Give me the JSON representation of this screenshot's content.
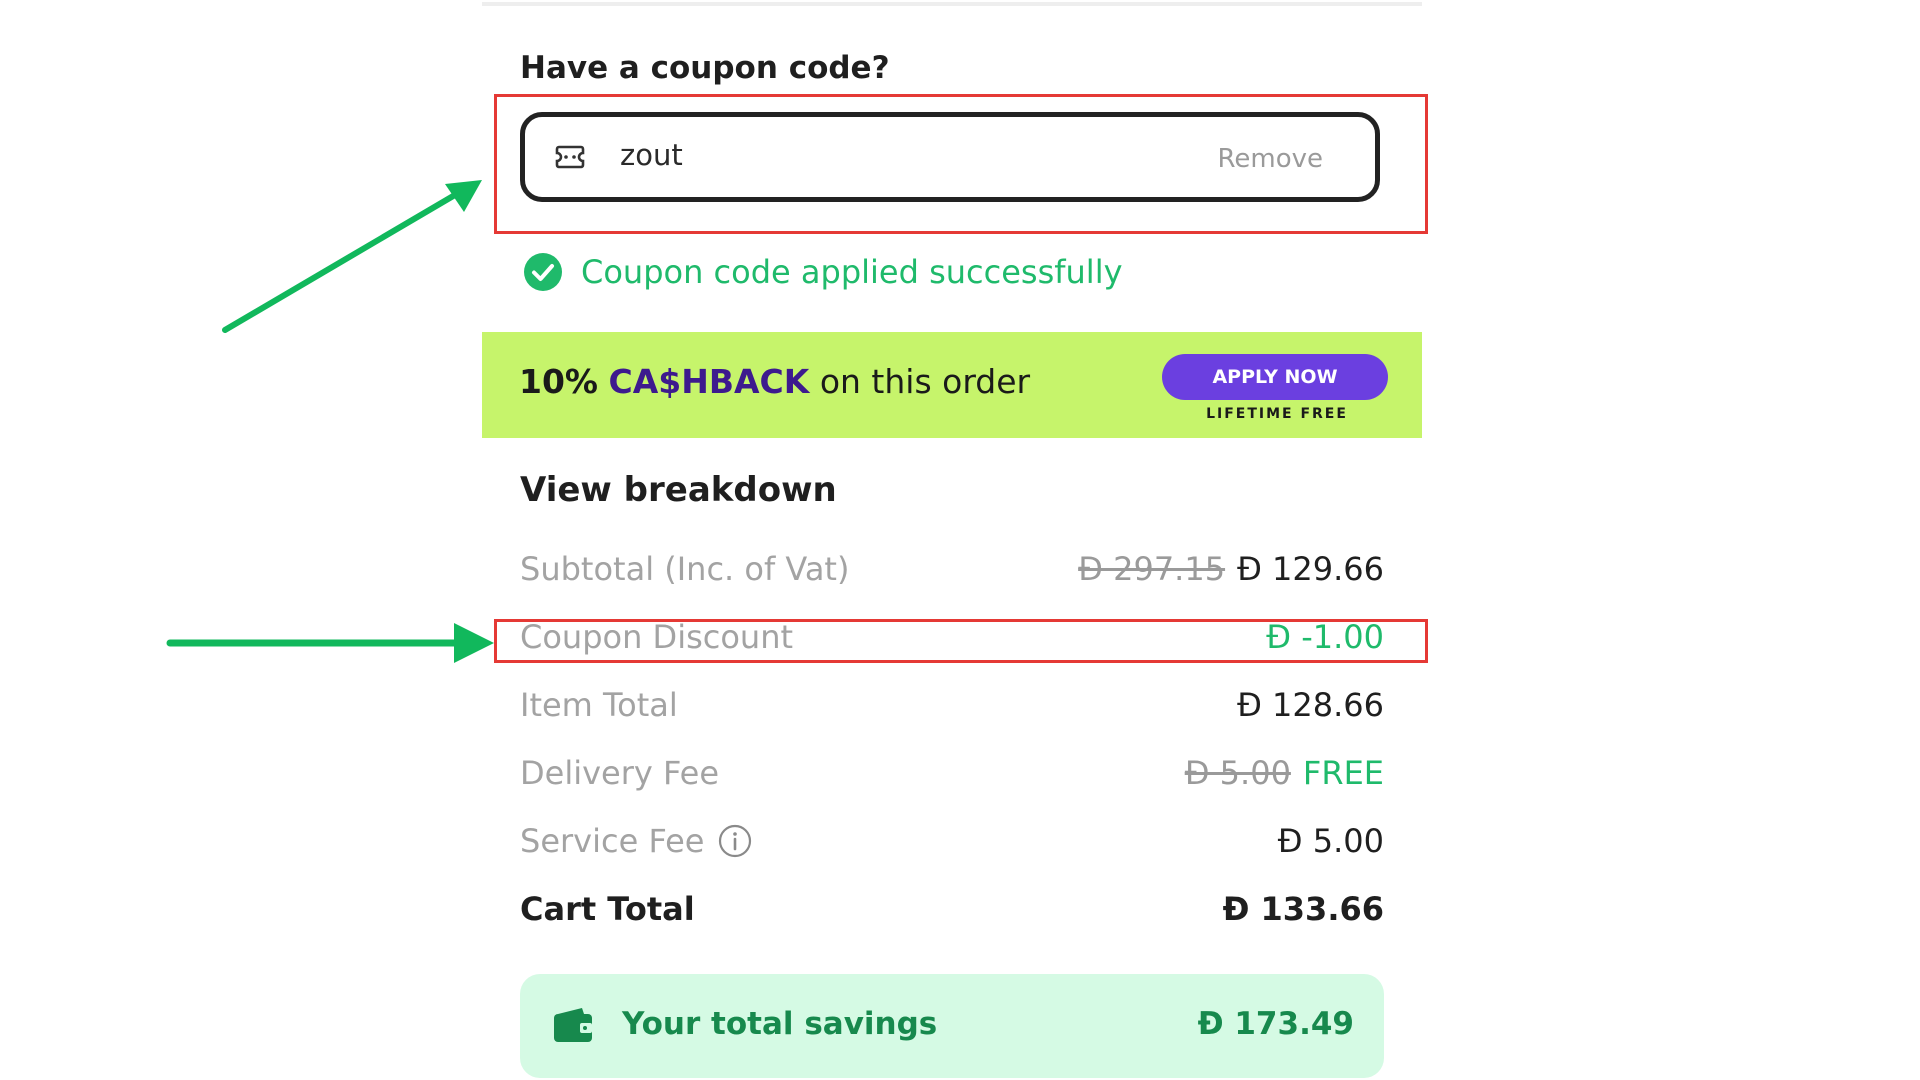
{
  "coupon": {
    "heading": "Have a coupon code?",
    "code_value": "zout",
    "remove_label": "Remove",
    "success_message": "Coupon code applied successfully"
  },
  "cashback_banner": {
    "percent": "10%",
    "brand": "CA$HBACK",
    "suffix": "on this order",
    "button_label": "APPLY NOW",
    "button_sublabel": "LIFETIME FREE"
  },
  "breakdown": {
    "heading": "View breakdown",
    "subtotal": {
      "label": "Subtotal (Inc. of Vat)",
      "original_value": "Ð 297.15",
      "value": "Ð 129.66"
    },
    "coupon_discount": {
      "label": "Coupon Discount",
      "value": "Ð -1.00"
    },
    "item_total": {
      "label": "Item Total",
      "value": "Ð 128.66"
    },
    "delivery_fee": {
      "label": "Delivery Fee",
      "original_value": "Ð 5.00",
      "value": "FREE"
    },
    "service_fee": {
      "label": "Service Fee",
      "value": "Ð 5.00"
    },
    "cart_total": {
      "label": "Cart Total",
      "value": "Ð 133.66"
    }
  },
  "savings": {
    "label": "Your total savings",
    "value": "Ð 173.49"
  },
  "colors": {
    "success_green": "#1fba6b",
    "savings_green": "#17894d",
    "banner_lime": "#c6f46b",
    "button_purple": "#6b3fe0",
    "brand_purple": "#3d1a8e",
    "highlight_red": "#e53935",
    "arrow_green": "#11b85c"
  },
  "icons": {
    "coupon": "ticket-icon",
    "success": "check-circle-icon",
    "info": "info-icon",
    "wallet": "wallet-icon",
    "annotation": "arrow-icon"
  }
}
